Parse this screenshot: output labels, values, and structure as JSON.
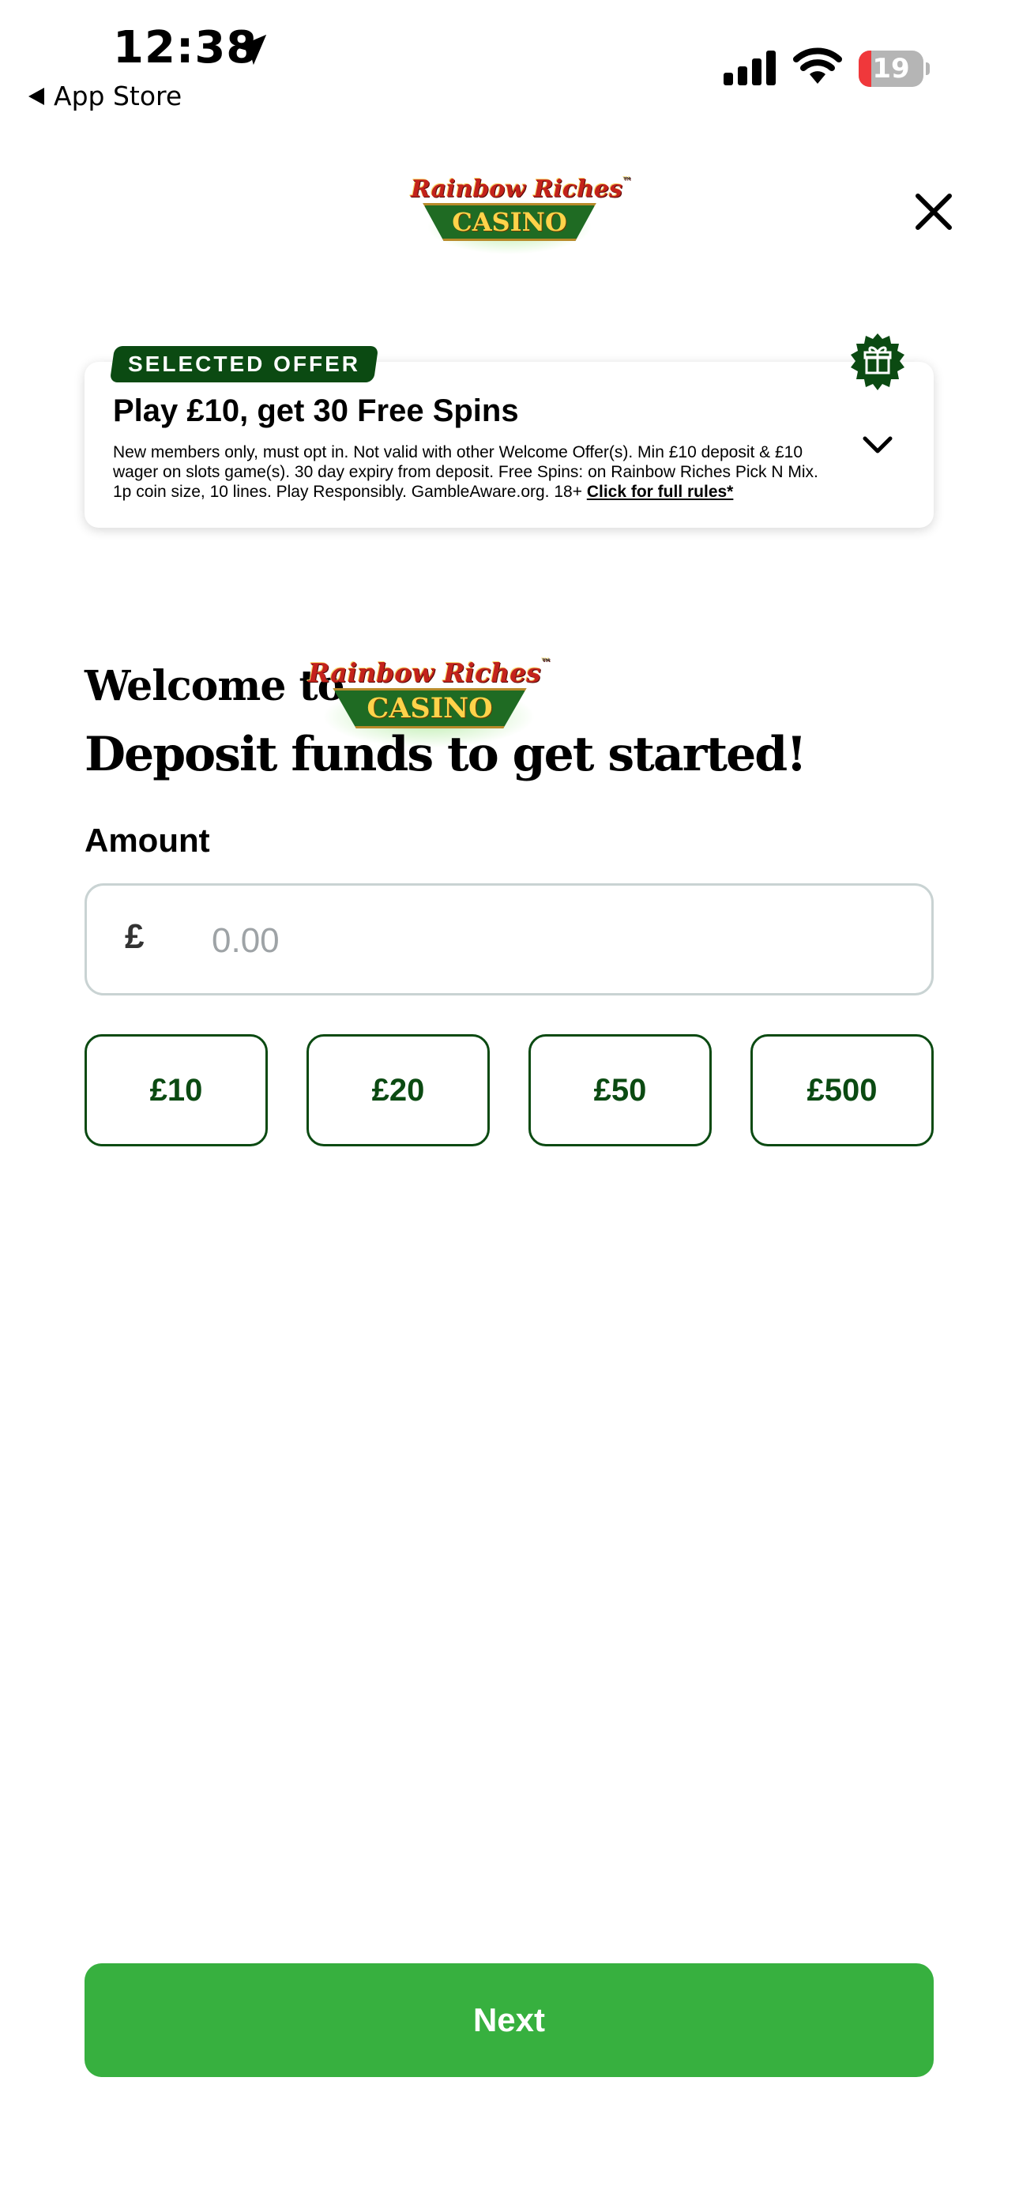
{
  "status_bar": {
    "time": "12:38",
    "back_label": "App Store",
    "battery_level": "19",
    "battery_fraction": 0.19,
    "battery_color": "#f0383b",
    "icons": [
      "location-arrow-icon",
      "cellular-signal-icon",
      "wifi-icon",
      "battery-icon"
    ]
  },
  "header": {
    "logo_top_text": "Rainbow Riches",
    "logo_bottom_text": "CASINO",
    "logo_tm": "™",
    "close_icon": "close-icon"
  },
  "offer": {
    "badge": "SELECTED OFFER",
    "title": "Play £10, get 30 Free Spins",
    "terms": "New members only, must opt in. Not valid with other Welcome Offer(s). Min £10 deposit & £10 wager on slots game(s). 30 day expiry from deposit. Free Spins: on Rainbow Riches Pick N Mix. 1p coin size, 10 lines. Play Responsibly. GambleAware.org. 18+",
    "rules_link": "Click for full rules*",
    "gift_icon": "gift-icon",
    "expand_icon": "chevron-down-icon",
    "badge_color": "#0b4a12"
  },
  "welcome": {
    "prefix": "Welcome to",
    "headline": "Deposit funds to get started!"
  },
  "amount": {
    "label": "Amount",
    "currency_symbol": "£",
    "value": "",
    "placeholder": "0.00"
  },
  "quick_amounts": [
    "£10",
    "£20",
    "£50",
    "£500"
  ],
  "next_button": {
    "label": "Next",
    "color": "#37b03f"
  }
}
